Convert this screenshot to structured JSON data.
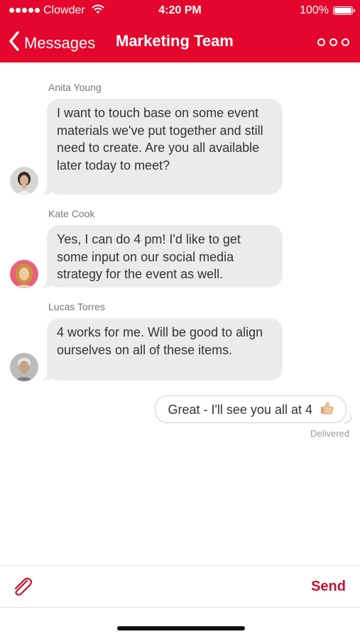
{
  "status_bar": {
    "carrier": "Clowder",
    "time": "4:20 PM",
    "battery": "100%"
  },
  "nav": {
    "back_label": "Messages",
    "title": "Marketing Team",
    "more_icon": "more-circles-icon"
  },
  "messages": [
    {
      "sender": "Anita Young",
      "text": "I want to touch base on some event materials we've put together and still need to create. Are you all available later today to meet?"
    },
    {
      "sender": "Kate Cook",
      "text": "Yes, I can do 4 pm! I'd like to get some input on our social media strategy for the event as well."
    },
    {
      "sender": "Lucas Torres",
      "text": "4 works for me. Will be good to align ourselves on all of these items."
    }
  ],
  "outgoing": {
    "text": "Great - I'll see you all at 4",
    "emoji": "thumbs-up-icon",
    "status": "Delivered"
  },
  "composer": {
    "attach_icon": "paperclip-icon",
    "send_label": "Send"
  },
  "colors": {
    "brand": "#e4062c",
    "send": "#c8102e",
    "bubble": "#ebebeb"
  }
}
